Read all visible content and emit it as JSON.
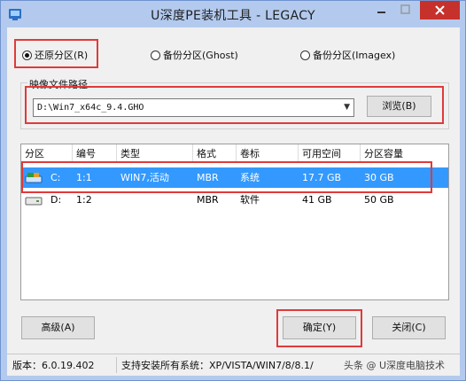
{
  "window": {
    "title": "U深度PE装机工具 - LEGACY",
    "close_color": "#c7312b"
  },
  "mode": {
    "options": [
      {
        "label": "还原分区(R)",
        "selected": true
      },
      {
        "label": "备份分区(Ghost)",
        "selected": false
      },
      {
        "label": "备份分区(Imagex)",
        "selected": false
      }
    ]
  },
  "image_path": {
    "group_label": "映像文件路径",
    "value": "D:\\Win7_x64c_9.4.GHO",
    "browse_label": "浏览(B)"
  },
  "table": {
    "columns": [
      "分区",
      "编号",
      "类型",
      "格式",
      "卷标",
      "可用空间",
      "分区容量"
    ],
    "rows": [
      {
        "drive": "C:",
        "number": "1:1",
        "type": "WIN7,活动",
        "format": "MBR",
        "label": "系统",
        "free": "17.7 GB",
        "capacity": "30 GB",
        "selected": true
      },
      {
        "drive": "D:",
        "number": "1:2",
        "type": "",
        "format": "MBR",
        "label": "软件",
        "free": "41 GB",
        "capacity": "50 GB",
        "selected": false
      }
    ]
  },
  "buttons": {
    "advanced": "高级(A)",
    "confirm": "确定(Y)",
    "close": "关闭(C)"
  },
  "status": {
    "version": "版本：6.0.19.402",
    "support": "支持安装所有系统：XP/VISTA/WIN7/8/8.1/",
    "extra": "头条 @ U深度电脑技术"
  },
  "highlight_color": "#e03a3a",
  "selection_color": "#3399ff"
}
